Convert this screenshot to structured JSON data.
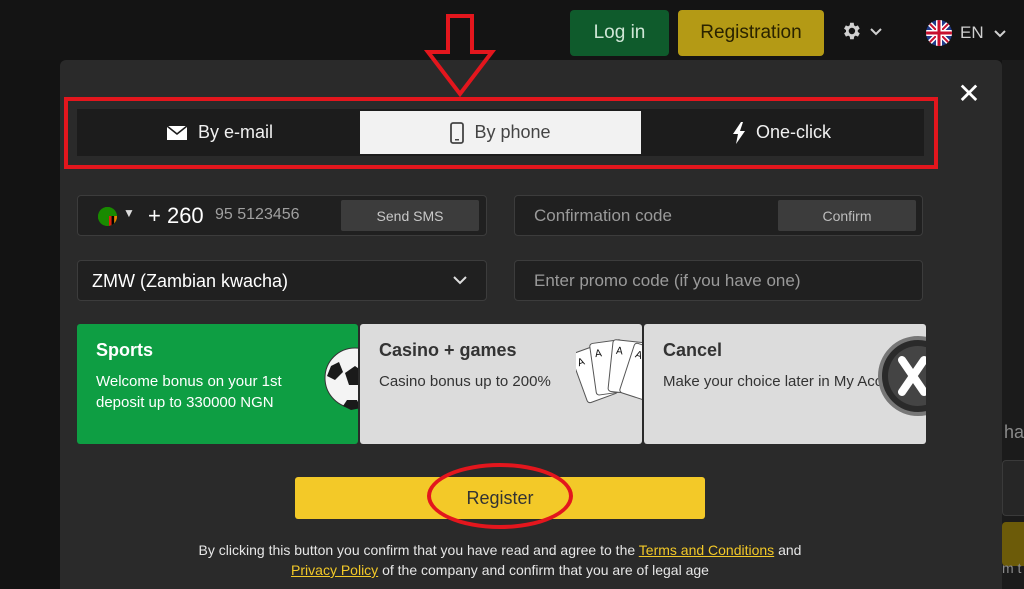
{
  "header": {
    "login_label": "Log in",
    "registration_label": "Registration",
    "language": "EN"
  },
  "modal": {
    "close_icon": "close-icon",
    "tabs": [
      {
        "label": "By e-mail",
        "icon": "envelope-icon"
      },
      {
        "label": "By phone",
        "icon": "phone-icon"
      },
      {
        "label": "One-click",
        "icon": "lightning-icon"
      }
    ],
    "active_tab": "By phone",
    "phone": {
      "country_code": "+ 260",
      "placeholder": "95 5123456",
      "send_sms_label": "Send SMS"
    },
    "confirmation": {
      "placeholder": "Confirmation code",
      "confirm_label": "Confirm"
    },
    "currency": {
      "selected": "ZMW (Zambian kwacha)"
    },
    "promo": {
      "placeholder": "Enter promo code (if you have one)"
    },
    "bonus_cards": [
      {
        "title": "Sports",
        "description": "Welcome bonus on your 1st deposit up to 330000 NGN"
      },
      {
        "title": "Casino + games",
        "description": "Casino bonus up to 200%"
      },
      {
        "title": "Cancel",
        "description": "Make your choice later in My Account"
      }
    ],
    "register_label": "Register",
    "legal": {
      "text_before": "By clicking this button you confirm that you have read and agree to the ",
      "terms_link": "Terms and Conditions",
      "and": " and ",
      "privacy_link": "Privacy Policy",
      "text_after": " of the company and confirm that you are of legal age"
    }
  },
  "background": {
    "partial_text_1": "ha",
    "partial_text_2": "m t"
  },
  "colors": {
    "annotation_red": "#e3161d",
    "register_yellow": "#f3c928",
    "sports_green": "#0e9e43",
    "login_green": "#0f5b2c"
  }
}
